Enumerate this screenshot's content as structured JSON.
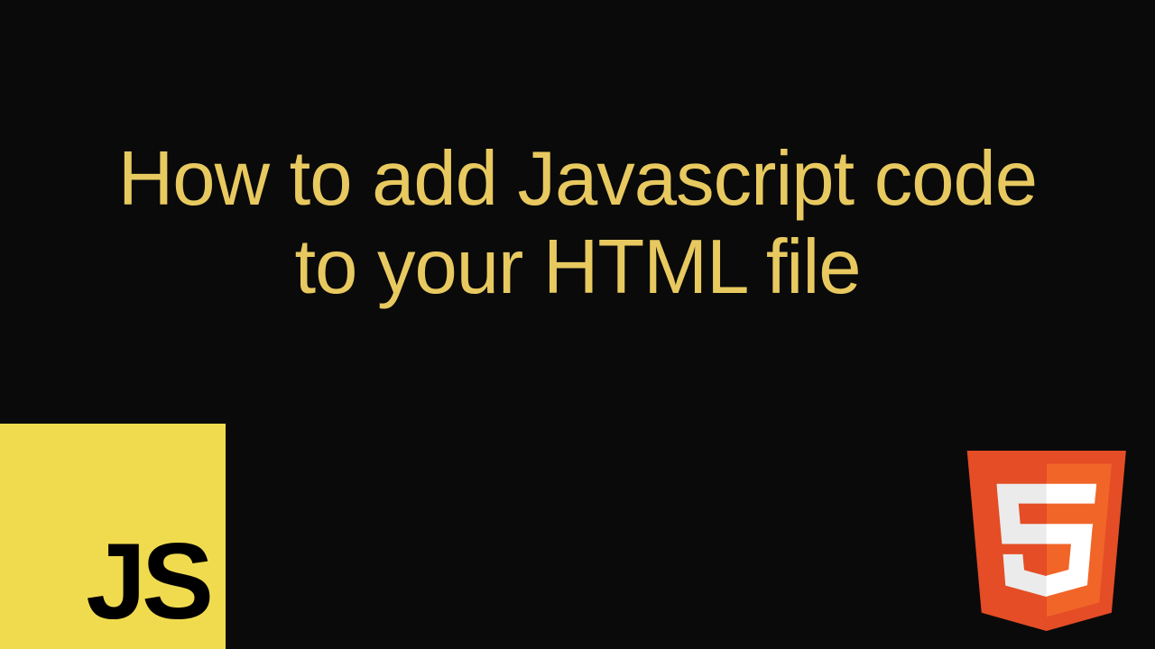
{
  "title": {
    "line1": "How to add Javascript code",
    "line2": "to your HTML file"
  },
  "logos": {
    "js_label": "JS",
    "html5_number": "5"
  },
  "colors": {
    "background": "#0a0a0a",
    "title_text": "#e8c960",
    "js_bg": "#f0db4f",
    "js_text": "#000000",
    "html5_shield": "#e44d26",
    "html5_shield_light": "#f16529",
    "html5_text": "#ffffff"
  }
}
